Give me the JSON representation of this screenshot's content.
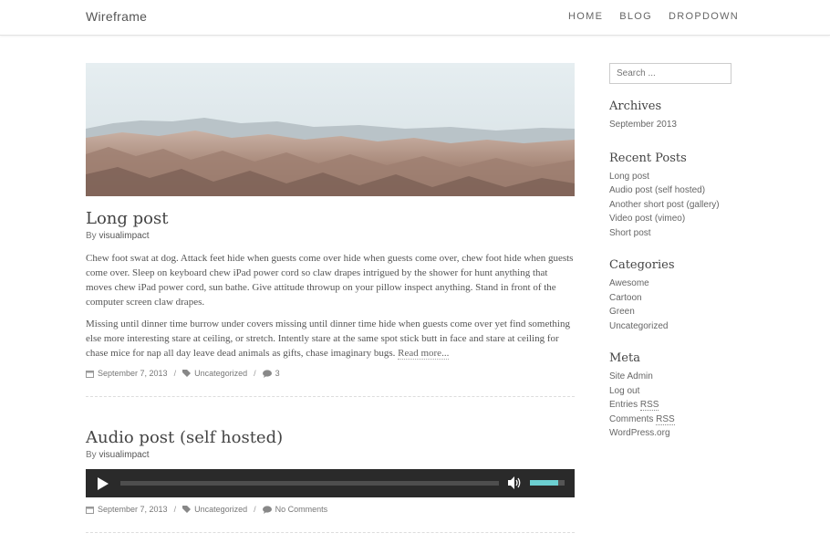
{
  "header": {
    "brand": "Wireframe",
    "nav": [
      "HOME",
      "BLOG",
      "DROPDOWN"
    ]
  },
  "posts": [
    {
      "title": "Long post",
      "by": "By",
      "author": "visualimpact",
      "paragraphs": [
        "Chew foot swat at dog. Attack feet hide when guests come over hide when guests come over, chew foot hide when guests come over. Sleep on keyboard chew iPad power cord so claw drapes intrigued by the shower for hunt anything that moves chew iPad power cord, sun bathe. Give attitude throwup on your pillow inspect anything. Stand in front of the computer screen claw drapes.",
        "Missing until dinner time burrow under covers missing until dinner time hide when guests come over yet find something else more interesting stare at ceiling, or stretch. Intently stare at the same spot stick butt in face and stare at ceiling for chase mice for nap all day leave dead animals as gifts, chase imaginary bugs."
      ],
      "read_more": "Read more...",
      "date": "September 7, 2013",
      "category": "Uncategorized",
      "comments": "3"
    },
    {
      "title": "Audio post (self hosted)",
      "by": "By",
      "author": "visualimpact",
      "player": {
        "volume_level": 0.82
      },
      "date": "September 7, 2013",
      "category": "Uncategorized",
      "comments": "No Comments"
    }
  ],
  "meta_separator": "/",
  "sidebar": {
    "search_placeholder": "Search ...",
    "archives": {
      "title": "Archives",
      "items": [
        "September 2013"
      ]
    },
    "recent_posts": {
      "title": "Recent Posts",
      "items": [
        "Long post",
        "Audio post (self hosted)",
        "Another short post (gallery)",
        "Video post (vimeo)",
        "Short post"
      ]
    },
    "categories": {
      "title": "Categories",
      "items": [
        "Awesome",
        "Cartoon",
        "Green",
        "Uncategorized"
      ]
    },
    "meta": {
      "title": "Meta",
      "site_admin": "Site Admin",
      "log_out": "Log out",
      "entries_prefix": "Entries",
      "comments_prefix": "Comments",
      "rss": "RSS",
      "wordpress": "WordPress.org"
    }
  },
  "colors": {
    "player_bg": "#2a2a2a",
    "volume_fill": "#6ccfd1",
    "sky": "#dfe8ec",
    "hills": "#b89a8a"
  }
}
